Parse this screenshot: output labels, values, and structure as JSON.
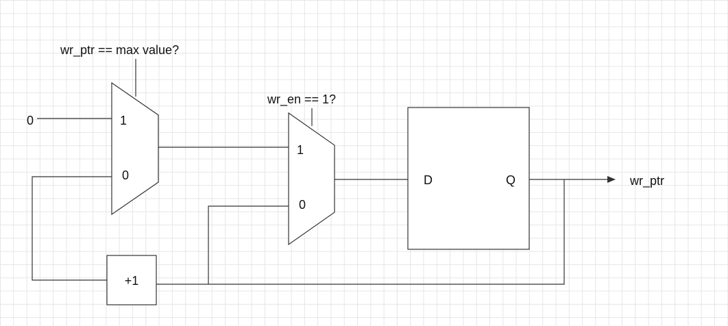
{
  "labels": {
    "mux1_select": "wr_ptr == max value?",
    "mux2_select": "wr_en == 1?",
    "const_zero": "0",
    "output_signal": "wr_ptr"
  },
  "mux1": {
    "in1": "1",
    "in0": "0"
  },
  "mux2": {
    "in1": "1",
    "in0": "0"
  },
  "flipflop": {
    "d": "D",
    "q": "Q"
  },
  "incrementer": {
    "label": "+1"
  },
  "colors": {
    "line": "#333333",
    "grid": "#e6e6e6",
    "background": "#ffffff"
  }
}
